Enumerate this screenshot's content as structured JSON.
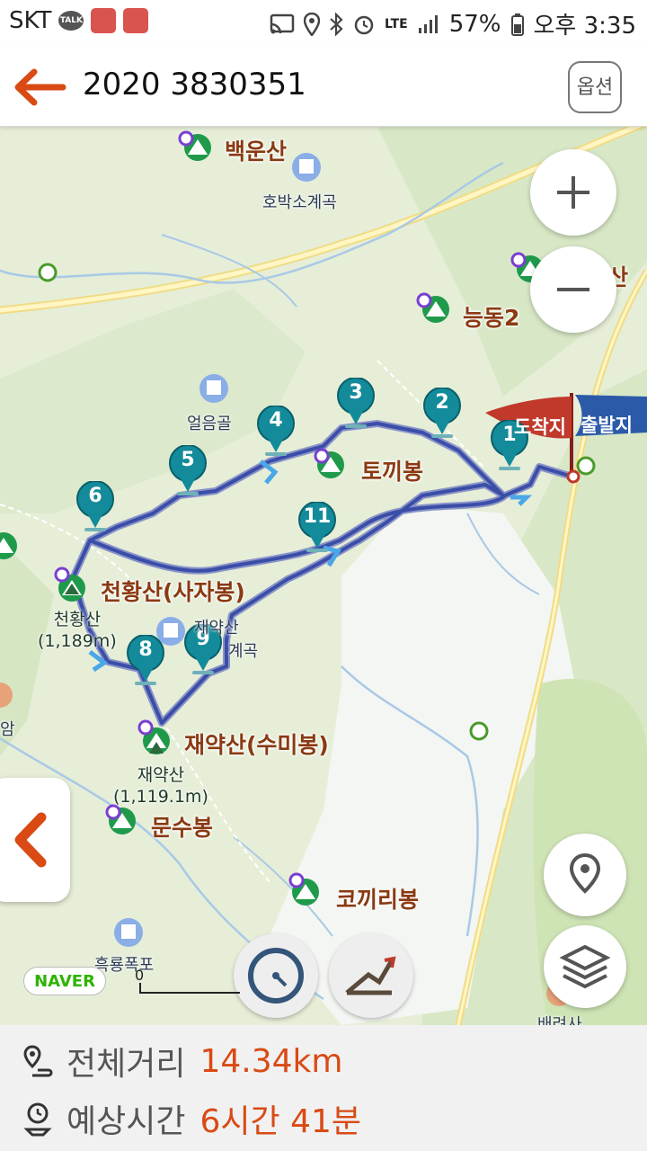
{
  "status_bar": {
    "carrier": "SKT",
    "talk_badge": "TALK",
    "network": "LTE",
    "battery": "57%",
    "time": "오후 3:35"
  },
  "header": {
    "title": "2020 3830351",
    "option_label": "옵션"
  },
  "map": {
    "peaks": {
      "baegun": "백운산",
      "neungdong": "능동2",
      "neungdong_tail": "산",
      "tokki": "토끼봉",
      "cheonhwang": "천황산(사자봉)",
      "jaeyak": "재약산(수미봉)",
      "munsu": "문수봉",
      "kokkiri": "코끼리봉"
    },
    "places": {
      "hobak": "호박소계곡",
      "eoleum": "얼음골",
      "jaeyak_valley_1": "재약산",
      "jaeyak_valley_2": "계곡",
      "heungnyong": "흑룡폭포",
      "baeryeon": "배려사",
      "edge_am": "암"
    },
    "summits": {
      "cheonhwang_name": "천황산",
      "cheonhwang_elev": "(1,189m)",
      "jaeyak_name": "재약산",
      "jaeyak_elev": "(1,119.1m)"
    },
    "flags": {
      "arrival": "도착지",
      "departure": "출발지"
    },
    "waypoints": [
      "1",
      "2",
      "3",
      "4",
      "5",
      "6",
      "8",
      "9",
      "11"
    ],
    "provider": "NAVER",
    "scale_zero": "0",
    "route_color": "#3a4ea8",
    "waypoint_color": "#138b9a",
    "accent_color": "#d94a14"
  },
  "summary": {
    "distance_label": "전체거리",
    "distance_value": "14.34km",
    "time_label": "예상시간",
    "time_value": "6시간 41분"
  }
}
